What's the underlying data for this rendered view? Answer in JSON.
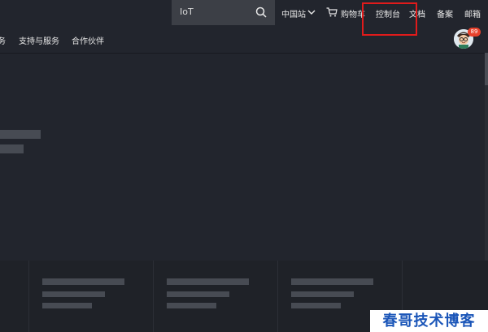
{
  "top_nav": {
    "search_query": "IoT",
    "region": "中国站",
    "cart": "购物车",
    "console": "控制台",
    "docs": "文档",
    "beian": "备案",
    "mail": "邮箱"
  },
  "sub_nav": {
    "partial_item": "务",
    "support": "支持与服务",
    "partners": "合作伙伴"
  },
  "user": {
    "notification_count": "89"
  },
  "watermark": "春哥技术博客",
  "colors": {
    "background": "#22252d",
    "highlight": "#e01b1b",
    "badge": "#e8412b",
    "watermark_text": "#1a55b8"
  }
}
